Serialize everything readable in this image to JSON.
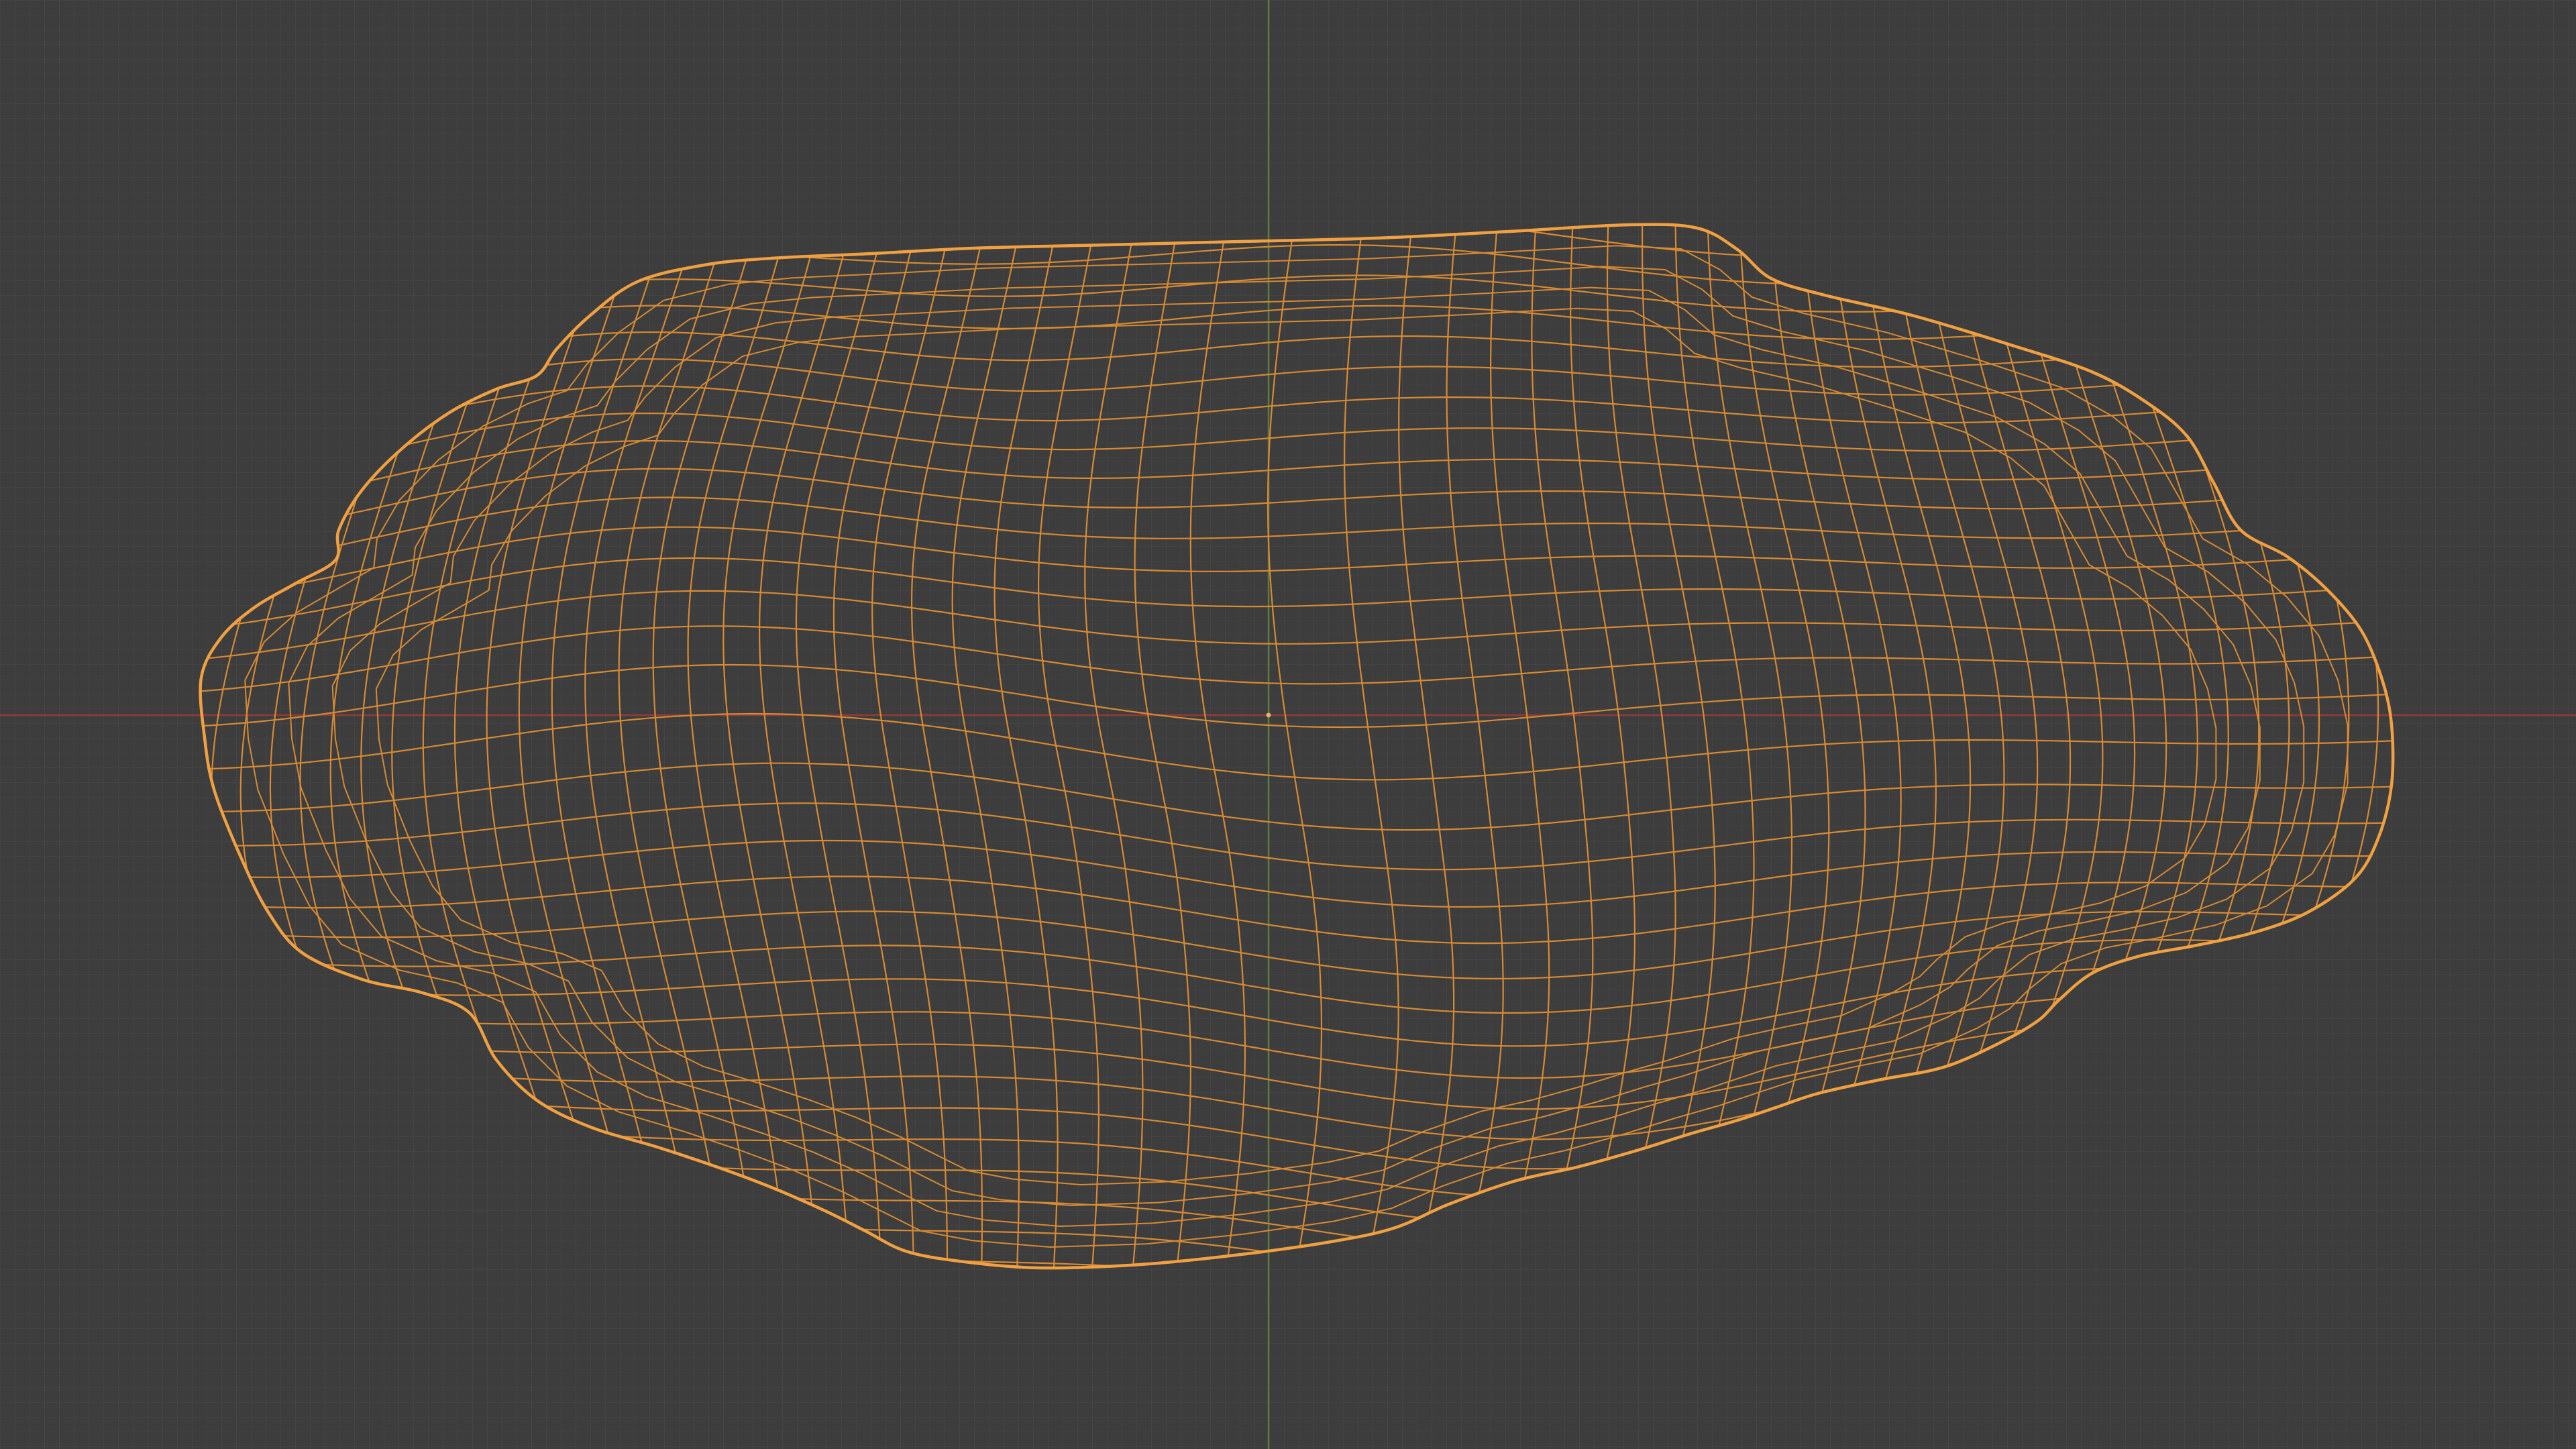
{
  "viewport": {
    "view": "wireframe",
    "mode": "object",
    "selected_object": "active-mesh",
    "background_color": "#3d3d3d",
    "grid_minor_color": "#454545",
    "grid_major_color": "#4a4a4a",
    "axis_x_color": "#8f3c3c",
    "axis_y_color": "#5f7a3a",
    "wire_color": "#d68a34",
    "outline_color": "#f0a040",
    "origin_color": "#e8b060"
  }
}
